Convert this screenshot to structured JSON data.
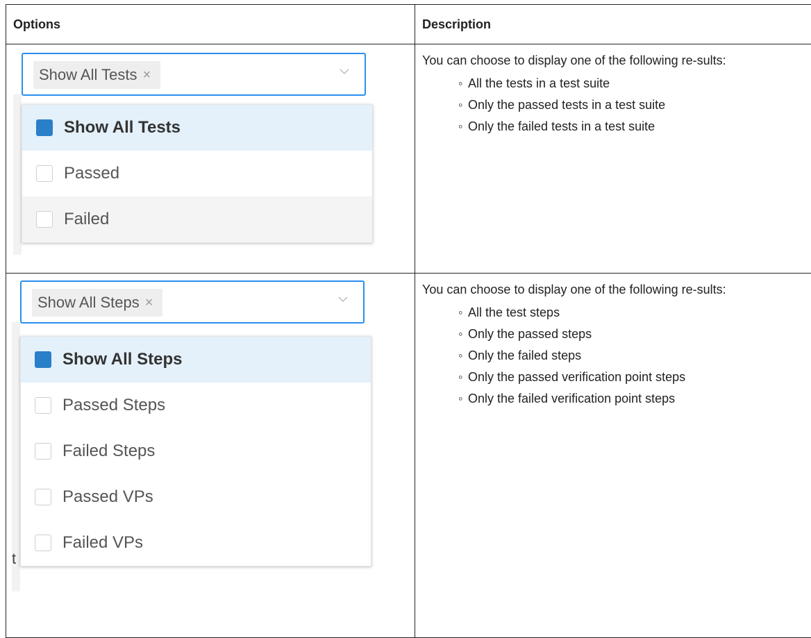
{
  "table": {
    "col_options": "Options",
    "col_description": "Description"
  },
  "rows": [
    {
      "select_chip": "Show All Tests",
      "chip_remove": "×",
      "items": [
        "Show All Tests",
        "Passed",
        "Failed"
      ],
      "selected_index": 0,
      "intro": "You can choose to display one of the following re-sults:",
      "bullets": [
        "All the tests in a test suite",
        "Only the passed tests in a test suite",
        "Only the failed tests in a test suite"
      ]
    },
    {
      "select_chip": "Show All Steps",
      "chip_remove": "×",
      "items": [
        "Show All Steps",
        "Passed Steps",
        "Failed Steps",
        "Passed VPs",
        "Failed VPs"
      ],
      "selected_index": 0,
      "side_letter": "t",
      "intro": "You can choose to display one of the following re-sults:",
      "bullets": [
        "All the test steps",
        "Only the passed steps",
        "Only the failed steps",
        "Only the passed verification point steps",
        "Only the failed verification point steps"
      ]
    }
  ],
  "colors": {
    "accent": "#2a8ff0",
    "checkbox": "#2a7fc9",
    "selected_row": "#e4f1fb"
  }
}
